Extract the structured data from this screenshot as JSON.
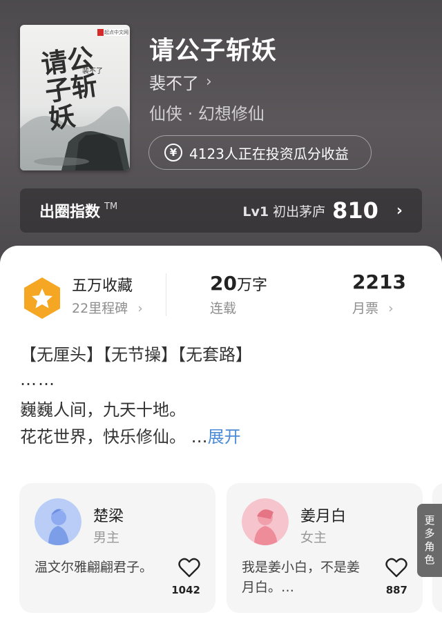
{
  "book": {
    "title": "请公子斩妖",
    "author": "裴不了",
    "genre": "仙侠 · 幻想修仙",
    "investors": "4123人正在投资瓜分收益",
    "cover": {
      "title_text": "请公子斩妖",
      "author_text": "裴不了",
      "publisher": "起点中文网"
    }
  },
  "index": {
    "label": "出圈指数",
    "tm": "TM",
    "level_prefix": "Lv1",
    "level_name": "初出茅庐",
    "score": "810"
  },
  "stats": {
    "collection": "五万收藏",
    "milestone": "22里程碑",
    "words_num": "20",
    "words_unit": "万字",
    "status": "连载",
    "tickets": "2213",
    "tickets_label": "月票"
  },
  "description": {
    "tags": "【无厘头】【无节操】【无套路】",
    "ellipsis": "……",
    "line1": "巍巍人间，九天十地。",
    "line2": "花花世界，快乐修仙。 …",
    "expand": "展开"
  },
  "characters": [
    {
      "name": "楚梁",
      "role": "男主",
      "desc": "温文尔雅翩翩君子。",
      "likes": "1042"
    },
    {
      "name": "姜月白",
      "role": "女主",
      "desc": "我是姜小白，不是姜月白。…",
      "likes": "887"
    }
  ],
  "more_roles": [
    "更",
    "多",
    "角",
    "色"
  ],
  "colors": {
    "header_bg": "#4d4a4d",
    "accent_blue": "#4a8ad6",
    "badge_orange": "#f5a623"
  }
}
